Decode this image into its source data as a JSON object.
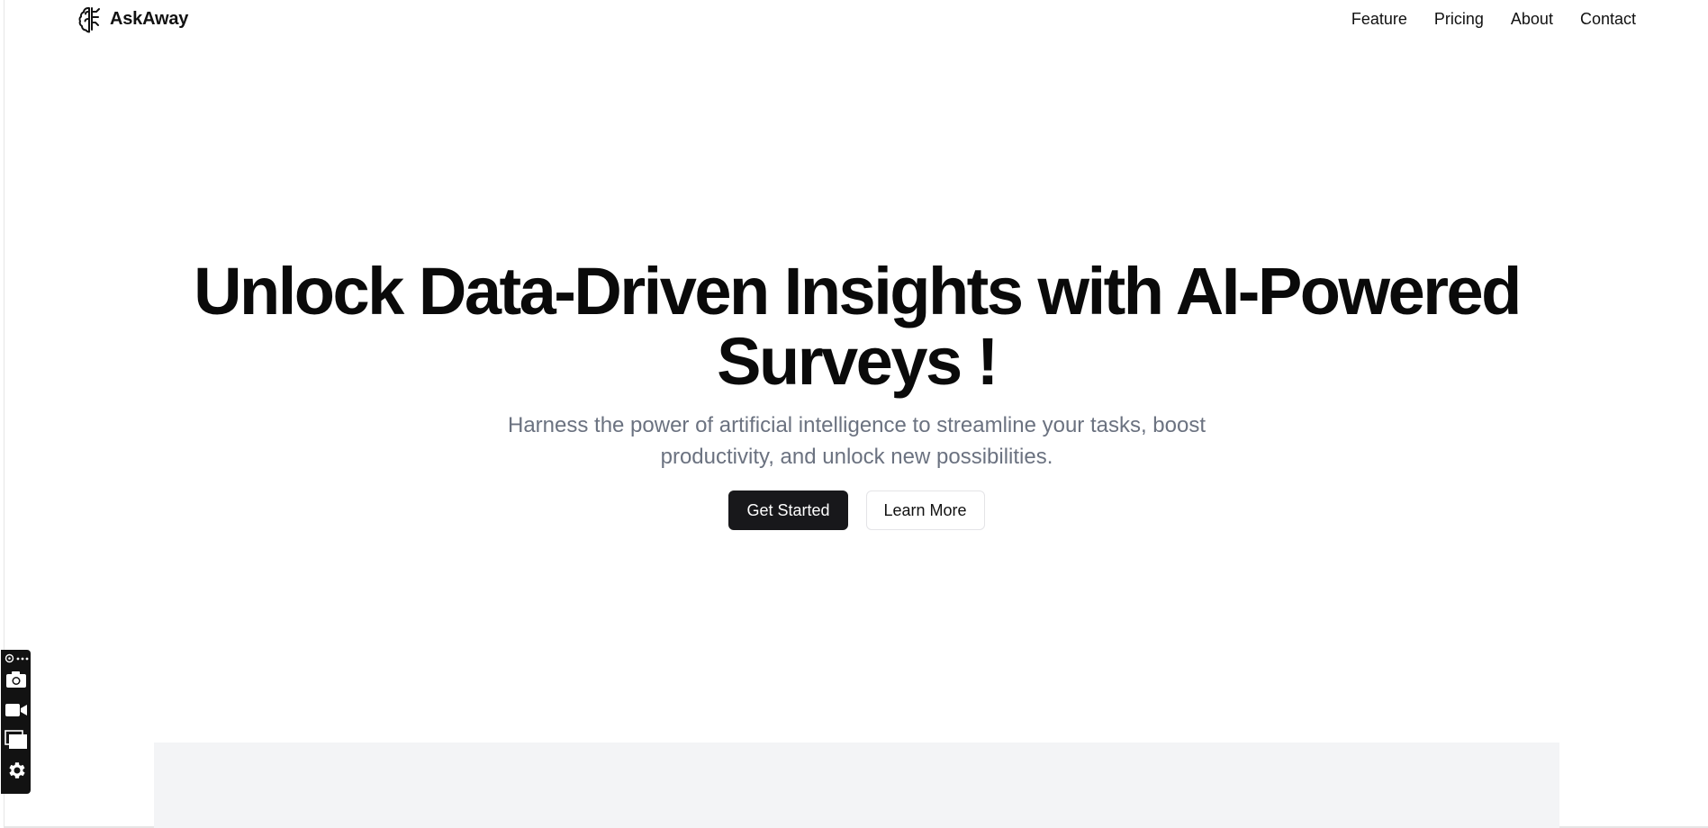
{
  "header": {
    "brand_name": "AskAway",
    "nav": [
      {
        "label": "Feature"
      },
      {
        "label": "Pricing"
      },
      {
        "label": "About"
      },
      {
        "label": "Contact"
      }
    ]
  },
  "hero": {
    "title": "Unlock Data-Driven Insights with AI-Powered Surveys !",
    "subtitle": "Harness the power of artificial intelligence to streamline your tasks, boost productivity, and unlock new possibilities.",
    "primary_button": "Get Started",
    "secondary_button": "Learn More"
  },
  "side_toolbar": {
    "icons": [
      "app-logo-icon",
      "more-options-icon",
      "camera-icon",
      "video-icon",
      "windows-icon",
      "gear-icon"
    ]
  },
  "colors": {
    "primary_button_bg": "#18181b",
    "subtitle_text": "#6b7280",
    "preview_block_bg": "#f3f4f6",
    "toolbar_bg": "#121212"
  }
}
